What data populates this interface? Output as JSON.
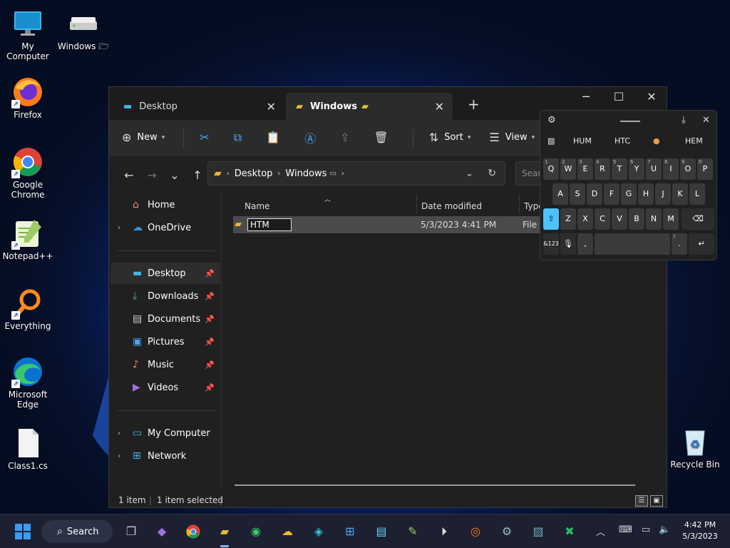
{
  "desktop_icons": [
    {
      "label": "My Computer",
      "icon": "monitor-icon"
    },
    {
      "label": "Windows 🗁",
      "icon": "drive-icon"
    },
    {
      "label": "Firefox",
      "icon": "firefox-icon"
    },
    {
      "label": "Google Chrome",
      "icon": "chrome-icon"
    },
    {
      "label": "Notepad++",
      "icon": "notepadpp-icon"
    },
    {
      "label": "Everything",
      "icon": "search-magnifier-icon"
    },
    {
      "label": "Microsoft Edge",
      "icon": "edge-icon"
    },
    {
      "label": "Class1.cs",
      "icon": "file-icon"
    },
    {
      "label": "Recycle Bin",
      "icon": "recycle-bin-icon"
    }
  ],
  "explorer": {
    "tabs": [
      {
        "label": "Desktop",
        "active": false
      },
      {
        "label": "Windows",
        "active": true
      }
    ],
    "toolbar": {
      "new_label": "New",
      "sort_label": "Sort",
      "view_label": "View"
    },
    "breadcrumb": [
      "Desktop",
      "Windows"
    ],
    "search_placeholder": "Search",
    "sidebar": {
      "home": "Home",
      "onedrive": "OneDrive",
      "pinned": [
        "Desktop",
        "Downloads",
        "Documents",
        "Pictures",
        "Music",
        "Videos"
      ],
      "my_computer": "My Computer",
      "network": "Network"
    },
    "columns": {
      "name": "Name",
      "date": "Date modified",
      "type": "Type"
    },
    "rows": [
      {
        "name": "HTM",
        "date": "5/3/2023 4:41 PM",
        "type": "File f"
      }
    ],
    "status": {
      "count": "1 item",
      "selected": "1 item selected"
    }
  },
  "keyboard": {
    "candidates": [
      "HUM",
      "HTC",
      "HEM"
    ],
    "row1": [
      {
        "k": "Q",
        "s": "1"
      },
      {
        "k": "W",
        "s": "2"
      },
      {
        "k": "E",
        "s": "3"
      },
      {
        "k": "R",
        "s": "4"
      },
      {
        "k": "T",
        "s": "5"
      },
      {
        "k": "Y",
        "s": "6"
      },
      {
        "k": "U",
        "s": "7"
      },
      {
        "k": "I",
        "s": "8"
      },
      {
        "k": "O",
        "s": "9"
      },
      {
        "k": "P",
        "s": "0"
      }
    ],
    "row2": [
      "A",
      "S",
      "D",
      "F",
      "G",
      "H",
      "J",
      "K",
      "L"
    ],
    "row3": [
      "Z",
      "X",
      "C",
      "V",
      "B",
      "N",
      "M"
    ],
    "num_key": "&123",
    "comma": ",",
    "period": ".",
    "period_sup": "?"
  },
  "taskbar": {
    "search_label": "Search",
    "time": "4:42 PM",
    "date": "5/3/2023"
  },
  "colors": {
    "accent": "#4cc2ff",
    "folder": "#e8b73a",
    "selection": "#4a4a4a"
  }
}
